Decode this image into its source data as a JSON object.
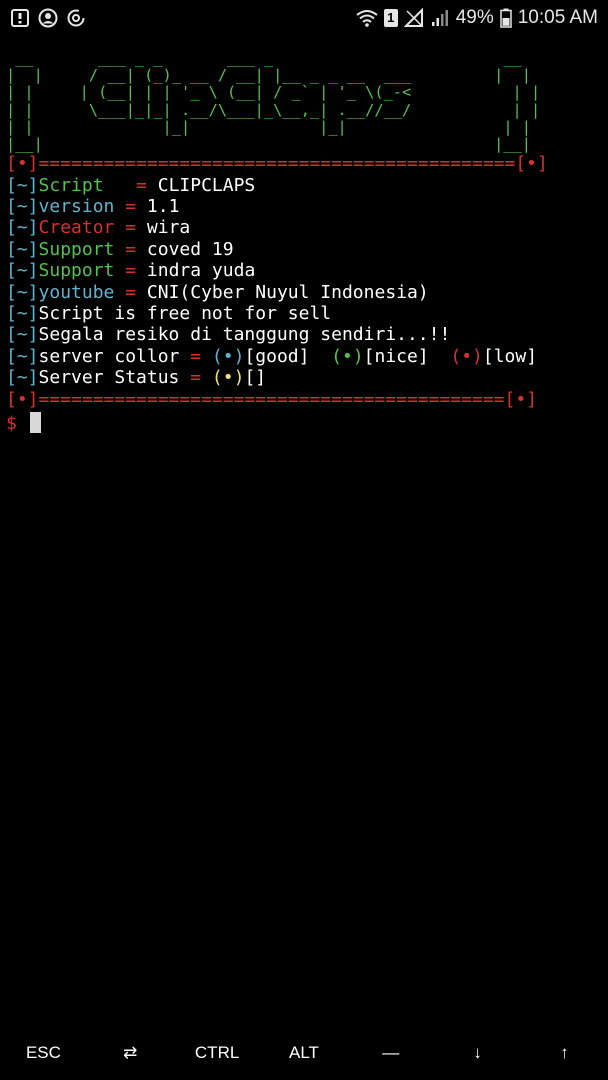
{
  "status_bar": {
    "battery_percent": "49%",
    "sim_number": "1",
    "time": "10:05 AM",
    "icons": [
      "notification-icon",
      "account-icon",
      "sync-icon",
      "wifi-icon",
      "sim-icon",
      "no-signal-icon",
      "signal-icon",
      "battery-icon"
    ]
  },
  "terminal": {
    "banner_art": [
      " __       ___ _ _       ___ _                         __ ",
      "|  |     / __| (_)_ __ / __| |__ _ _ __  ___         |  |",
      "| |     | (__| | | '_ \\ (__| / _` | '_ \\(_-<           | |",
      "| |      \\___|_|_| .__/\\___|_\\__,_| .__//__/           | |",
      "| |              |_|              |_|                 | |",
      "|__|                                                 |__|"
    ],
    "top_divider": {
      "left": "[•]",
      "bar": "============================================",
      "right": "[•]"
    },
    "info": [
      {
        "prefix": "[~]",
        "key": "Script  ",
        "eq": " = ",
        "value": "CLIPCLAPS"
      },
      {
        "prefix": "[~]",
        "key": "version ",
        "eq": "= ",
        "value": "1.1"
      },
      {
        "prefix": "[~]",
        "key": "Creator ",
        "eq": "= ",
        "value": "wira"
      },
      {
        "prefix": "[~]",
        "key": "Support ",
        "eq": "= ",
        "value": "coved 19"
      },
      {
        "prefix": "[~]",
        "key": "Support ",
        "eq": "= ",
        "value": "indra yuda"
      },
      {
        "prefix": "[~]",
        "key": "youtube ",
        "eq": "= ",
        "value": "CNI(Cyber Nuyul Indonesia)"
      }
    ],
    "notes": [
      {
        "prefix": "[~]",
        "text": "Script is free not for sell"
      },
      {
        "prefix": "[~]",
        "text": "Segala resiko di tanggung sendiri...!!"
      }
    ],
    "server_collor": {
      "prefix": "[~]",
      "label": "server collor ",
      "eq": "= ",
      "good_dot": "(•)",
      "good": "[good]  ",
      "nice_dot": "(•)",
      "nice": "[nice]  ",
      "low_dot": "(•)",
      "low": "[low]"
    },
    "server_status": {
      "prefix": "[~]",
      "label": "Server Status ",
      "eq": "= ",
      "dot": "(•)",
      "value": "[]"
    },
    "bottom_divider": {
      "left": "[•]",
      "bar": "===========================================",
      "right": "[•]"
    },
    "prompt": "$ "
  },
  "extra_keys": [
    {
      "name": "esc-key",
      "label": "ESC"
    },
    {
      "name": "tab-key",
      "label": "⇄"
    },
    {
      "name": "ctrl-key",
      "label": "CTRL"
    },
    {
      "name": "alt-key",
      "label": "ALT"
    },
    {
      "name": "dash-key",
      "label": "—"
    },
    {
      "name": "arrow-down-key",
      "label": "↓"
    },
    {
      "name": "arrow-up-key",
      "label": "↑"
    }
  ],
  "colors": {
    "background": "#000000",
    "art_green": "#52c24a",
    "red": "#d6312b",
    "cyan": "#5fb3ce",
    "yellow": "#f1e07a"
  }
}
